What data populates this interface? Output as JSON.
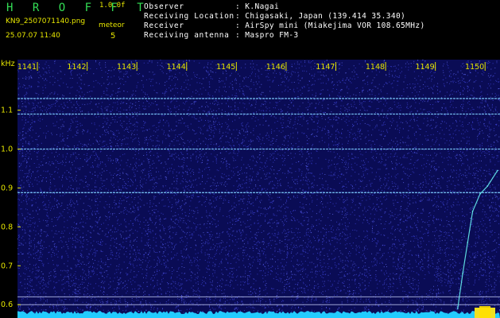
{
  "header": {
    "app_title": "H R O F F T",
    "version": "1.0.0f",
    "filename": "KN9_2507071140.png",
    "datetime": "25.07.07 11:40",
    "meteor_label": "meteor",
    "meteor_count": "5"
  },
  "observer_info": [
    {
      "label": "Observer",
      "value": ": K.Nagai"
    },
    {
      "label": "Receiving Location",
      "value": ": Chigasaki, Japan (139.414 35.340)"
    },
    {
      "label": "Receiver",
      "value": ": AirSpy mini (Miakejima VOR 108.65MHz)"
    },
    {
      "label": "Receiving antenna",
      "value": ": Maspro FM-3"
    }
  ],
  "colors": {
    "background": "#000000",
    "plot_bg": "#0a0c55",
    "noise": "#3a3fd0",
    "text_yellow": "#e6e600",
    "title_green": "#33dd55",
    "trace_cyan": "#66eeee",
    "floor": "#22ccff"
  },
  "chart_data": {
    "type": "heatmap",
    "x_label": "",
    "y_unit": "kHz",
    "x_ticks": [
      "1141",
      "1142",
      "1143",
      "1144",
      "1145",
      "1146",
      "1147",
      "1148",
      "1149",
      "1150"
    ],
    "y_ticks": [
      "1.1",
      "1.0",
      "0.9",
      "0.8",
      "0.7",
      "0.6"
    ],
    "y_tick_values": [
      1.1,
      1.0,
      0.9,
      0.8,
      0.7,
      0.6
    ],
    "ylim": [
      0.58,
      1.23
    ],
    "x_range": [
      1140.6,
      1150.3
    ],
    "carrier_lines_khz": [
      1.13,
      1.09,
      1.0,
      0.888,
      0.62,
      0.6
    ],
    "meteor_trace": [
      {
        "x": 1149.45,
        "y": 0.59
      },
      {
        "x": 1149.55,
        "y": 0.68
      },
      {
        "x": 1149.65,
        "y": 0.76
      },
      {
        "x": 1149.75,
        "y": 0.84
      },
      {
        "x": 1149.9,
        "y": 0.885
      },
      {
        "x": 1150.05,
        "y": 0.905
      },
      {
        "x": 1150.25,
        "y": 0.945
      }
    ]
  }
}
